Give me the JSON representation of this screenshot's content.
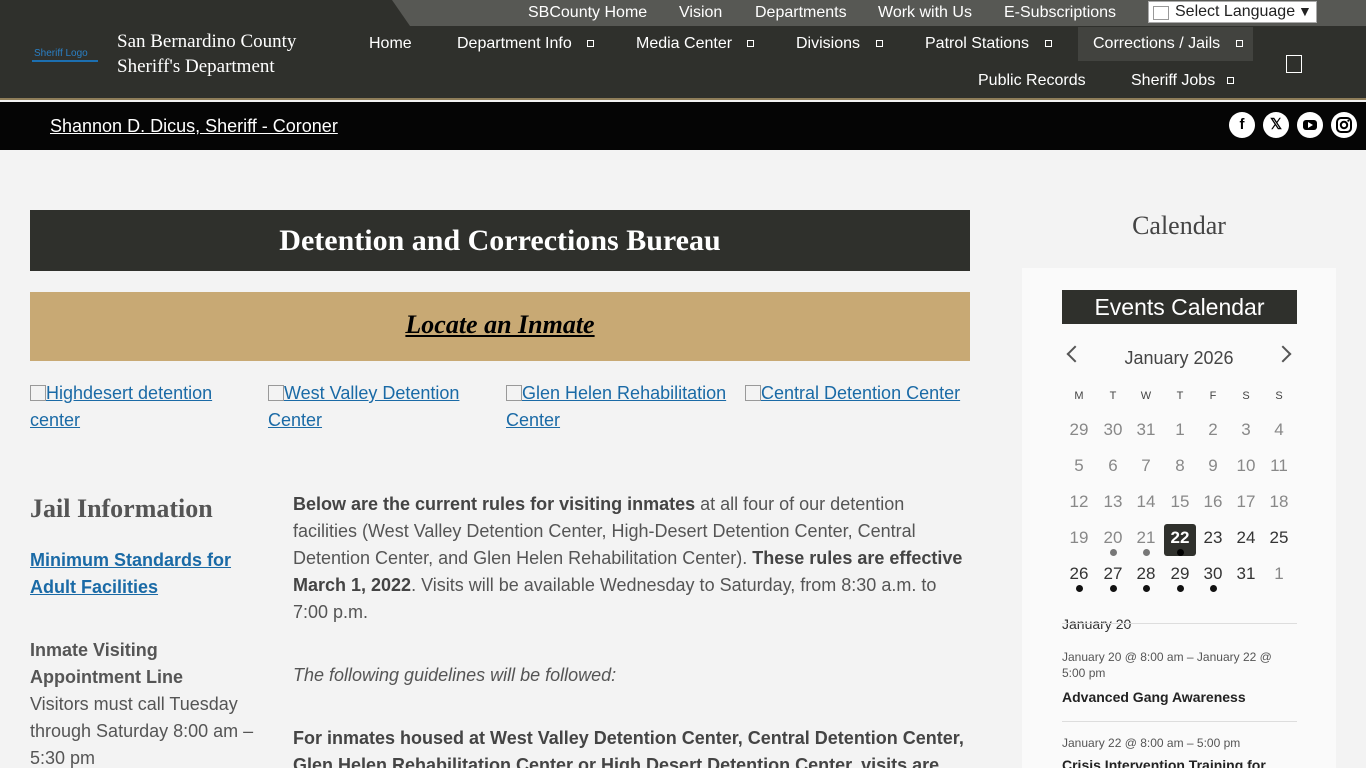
{
  "utility_nav": {
    "links": [
      "SBCounty Home",
      "Vision",
      "Departments",
      "Work with Us",
      "E-Subscriptions"
    ],
    "language": "Select Language"
  },
  "logo": {
    "alt": "Sheriff Logo"
  },
  "org": {
    "line1": "San Bernardino County",
    "line2": "Sheriff's Department"
  },
  "main_nav": {
    "row1": [
      "Home",
      "Department Info",
      "Media Center",
      "Divisions",
      "Patrol Stations",
      "Corrections / Jails"
    ],
    "row2": [
      "Public Records",
      "Sheriff Jobs"
    ]
  },
  "sheriff_bar": {
    "name": "Shannon D. Dicus, Sheriff - Coroner"
  },
  "social": [
    "facebook-icon",
    "x-icon",
    "youtube-icon",
    "instagram-icon"
  ],
  "page": {
    "title": "Detention and Corrections Bureau",
    "locate": "Locate an Inmate",
    "facilities": [
      "Highdesert detention center",
      "West Valley Detention Center",
      "Glen Helen Rehabilitation Center",
      "Central Detention Center"
    ],
    "jail_info": {
      "heading": "Jail Information",
      "min_standards": "Minimum Standards for Adult Facilities",
      "visiting_heading": "Inmate Visiting Appointment Line",
      "visiting_text": "Visitors must call Tuesday through Saturday 8:00 am – 5:30 pm"
    },
    "rules": {
      "bold1": "Below are the current rules for visiting inmates",
      "text1": " at all four of our detention facilities (West Valley Detention Center, High-Desert Detention Center, Central Detention Center, and Glen Helen Rehabilitation Center).  ",
      "bold2": "These rules are effective March 1, 2022",
      "text2": ".  Visits will be available Wednesday to Saturday, from 8:30 a.m. to 7:00 p.m.",
      "guidelines": "The following guidelines will be followed:",
      "inmates": "For inmates housed at West Valley Detention Center, Central Detention Center, Glen Helen Rehabilitation Center or High Desert Detention Center, visits are"
    }
  },
  "sidebar": {
    "heading": "Calendar",
    "events_title": "Events Calendar",
    "month": "January 2026",
    "dow": [
      "M",
      "T",
      "W",
      "T",
      "F",
      "S",
      "S"
    ],
    "weeks": [
      [
        "29",
        "30",
        "31",
        "1",
        "2",
        "3",
        "4"
      ],
      [
        "5",
        "6",
        "7",
        "8",
        "9",
        "10",
        "11"
      ],
      [
        "12",
        "13",
        "14",
        "15",
        "16",
        "17",
        "18"
      ],
      [
        "19",
        "20",
        "21",
        "22",
        "23",
        "24",
        "25"
      ],
      [
        "26",
        "27",
        "28",
        "29",
        "30",
        "31",
        "1"
      ]
    ],
    "list_date": "January 20",
    "events": [
      {
        "meta": "January 20 @ 8:00 am – January 22 @ 5:00 pm",
        "title": "Advanced Gang Awareness"
      },
      {
        "meta": "January 22 @ 8:00 am – 5:00 pm",
        "title": "Crisis Intervention Training for"
      }
    ]
  },
  "colors": {
    "header_bg": "#2f302c",
    "gold": "#c8a974",
    "link_blue": "#1a6aa6"
  }
}
